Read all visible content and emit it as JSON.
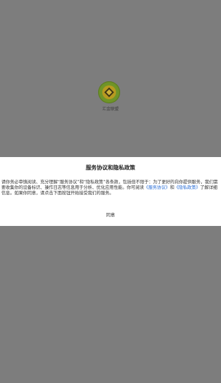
{
  "app": {
    "name": "汇金联盟",
    "logo_icon": "gold-coin-icon"
  },
  "dialog": {
    "title": "服务协议和隐私政策",
    "body_part1": "请你务必审慎阅读、充分理解“服务协议”和“隐私政策”各条款，包括但不限于：为了更好的向你提供服务，我们需要收集你的设备标识、操作日志等信息用于分析、优化应用性能。你可阅读",
    "service_agreement_link": "《服务协议》",
    "conjunction": "和",
    "privacy_policy_link": "《隐私政策》",
    "body_part2": "了解详细信息。如果你同意，请点击下面按钮开始接受我们的服务。",
    "agree_label": "同意"
  },
  "colors": {
    "overlay": "#7d7d7d",
    "link": "#2a6ed6",
    "dialog_bg": "#ffffff"
  }
}
